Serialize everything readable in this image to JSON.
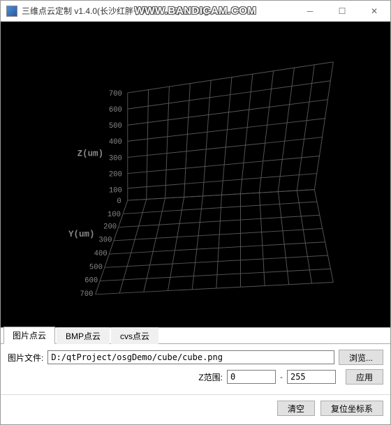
{
  "window": {
    "title": "三维点云定制 v1.4.0(长沙红胖子网络 … 网址: blog....",
    "watermark": "WWW.BANDICAM.COM"
  },
  "viewport": {
    "z_axis_label": "Z(um)",
    "y_axis_label": "Y(um)",
    "z_ticks": [
      "700",
      "600",
      "500",
      "400",
      "300",
      "200",
      "100",
      "0"
    ],
    "y_ticks": [
      "100",
      "200",
      "300",
      "400",
      "500",
      "600",
      "700"
    ]
  },
  "tabs": [
    {
      "label": "图片点云",
      "active": true
    },
    {
      "label": "BMP点云",
      "active": false
    },
    {
      "label": "cvs点云",
      "active": false
    }
  ],
  "panel": {
    "file_label": "图片文件:",
    "file_value": "D:/qtProject/osgDemo/cube/cube.png",
    "browse_label": "浏览...",
    "zrange_label": "Z范围:",
    "zrange_min": "0",
    "zrange_max": "255",
    "apply_label": "应用"
  },
  "footer": {
    "clear_label": "清空",
    "reset_label": "复位坐标系"
  },
  "chart_data": {
    "type": "3d-grid",
    "title": "",
    "axes": {
      "Z": {
        "label": "Z(um)",
        "range": [
          0,
          700
        ],
        "ticks": [
          0,
          100,
          200,
          300,
          400,
          500,
          600,
          700
        ]
      },
      "Y": {
        "label": "Y(um)",
        "range": [
          0,
          700
        ],
        "ticks": [
          0,
          100,
          200,
          300,
          400,
          500,
          600,
          700
        ]
      }
    },
    "series": [],
    "note": "Empty 3D coordinate grid, no point cloud loaded yet"
  }
}
